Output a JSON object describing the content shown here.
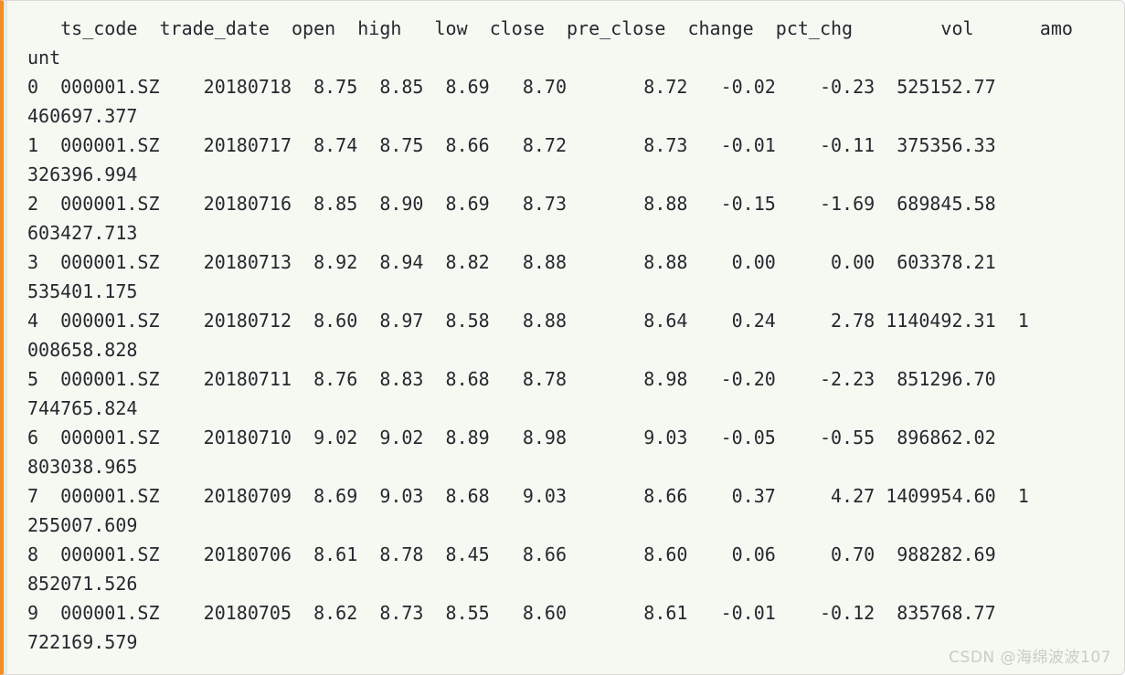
{
  "theme": {
    "background": "#f6f8f2",
    "text_color": "#24292e",
    "accent_border": "#f08d24",
    "panel_border": "#d9d9d9",
    "watermark_color": "#c9cdc6"
  },
  "console": {
    "columns": [
      "ts_code",
      "trade_date",
      "open",
      "high",
      "low",
      "close",
      "pre_close",
      "change",
      "pct_chg",
      "vol",
      "amount"
    ],
    "index_label": "",
    "lines": [
      "   ts_code  trade_date  open  high   low  close  pre_close  change  pct_chg        vol      amo",
      "unt",
      "0  000001.SZ    20180718  8.75  8.85  8.69   8.70       8.72   -0.02    -0.23  525152.77         ",
      "460697.377",
      "1  000001.SZ    20180717  8.74  8.75  8.66   8.72       8.73   -0.01    -0.11  375356.33         ",
      "326396.994",
      "2  000001.SZ    20180716  8.85  8.90  8.69   8.73       8.88   -0.15    -1.69  689845.58         ",
      "603427.713",
      "3  000001.SZ    20180713  8.92  8.94  8.82   8.88       8.88    0.00     0.00  603378.21         ",
      "535401.175",
      "4  000001.SZ    20180712  8.60  8.97  8.58   8.88       8.64    0.24     2.78 1140492.31  1",
      "008658.828",
      "5  000001.SZ    20180711  8.76  8.83  8.68   8.78       8.98   -0.20    -2.23  851296.70         ",
      "744765.824",
      "6  000001.SZ    20180710  9.02  9.02  8.89   8.98       9.03   -0.05    -0.55  896862.02         ",
      "803038.965",
      "7  000001.SZ    20180709  8.69  9.03  8.68   9.03       8.66    0.37     4.27 1409954.60  1",
      "255007.609",
      "8  000001.SZ    20180706  8.61  8.78  8.45   8.66       8.60    0.06     0.70  988282.69         ",
      "852071.526",
      "9  000001.SZ    20180705  8.62  8.73  8.55   8.60       8.61   -0.01    -0.12  835768.77         ",
      "722169.579"
    ],
    "rows": [
      {
        "index": "0",
        "ts_code": "000001.SZ",
        "trade_date": "20180718",
        "open": "8.75",
        "high": "8.85",
        "low": "8.69",
        "close": "8.70",
        "pre_close": "8.72",
        "change": "-0.02",
        "pct_chg": "-0.23",
        "vol": "525152.77",
        "amount": "460697.377"
      },
      {
        "index": "1",
        "ts_code": "000001.SZ",
        "trade_date": "20180717",
        "open": "8.74",
        "high": "8.75",
        "low": "8.66",
        "close": "8.72",
        "pre_close": "8.73",
        "change": "-0.01",
        "pct_chg": "-0.11",
        "vol": "375356.33",
        "amount": "326396.994"
      },
      {
        "index": "2",
        "ts_code": "000001.SZ",
        "trade_date": "20180716",
        "open": "8.85",
        "high": "8.90",
        "low": "8.69",
        "close": "8.73",
        "pre_close": "8.88",
        "change": "-0.15",
        "pct_chg": "-1.69",
        "vol": "689845.58",
        "amount": "603427.713"
      },
      {
        "index": "3",
        "ts_code": "000001.SZ",
        "trade_date": "20180713",
        "open": "8.92",
        "high": "8.94",
        "low": "8.82",
        "close": "8.88",
        "pre_close": "8.88",
        "change": "0.00",
        "pct_chg": "0.00",
        "vol": "603378.21",
        "amount": "535401.175"
      },
      {
        "index": "4",
        "ts_code": "000001.SZ",
        "trade_date": "20180712",
        "open": "8.60",
        "high": "8.97",
        "low": "8.58",
        "close": "8.88",
        "pre_close": "8.64",
        "change": "0.24",
        "pct_chg": "2.78",
        "vol": "1140492.31",
        "amount": "1008658.828"
      },
      {
        "index": "5",
        "ts_code": "000001.SZ",
        "trade_date": "20180711",
        "open": "8.76",
        "high": "8.83",
        "low": "8.68",
        "close": "8.78",
        "pre_close": "8.98",
        "change": "-0.20",
        "pct_chg": "-2.23",
        "vol": "851296.70",
        "amount": "744765.824"
      },
      {
        "index": "6",
        "ts_code": "000001.SZ",
        "trade_date": "20180710",
        "open": "9.02",
        "high": "9.02",
        "low": "8.89",
        "close": "8.98",
        "pre_close": "9.03",
        "change": "-0.05",
        "pct_chg": "-0.55",
        "vol": "896862.02",
        "amount": "803038.965"
      },
      {
        "index": "7",
        "ts_code": "000001.SZ",
        "trade_date": "20180709",
        "open": "8.69",
        "high": "9.03",
        "low": "8.68",
        "close": "9.03",
        "pre_close": "8.66",
        "change": "0.37",
        "pct_chg": "4.27",
        "vol": "1409954.60",
        "amount": "1255007.609"
      },
      {
        "index": "8",
        "ts_code": "000001.SZ",
        "trade_date": "20180706",
        "open": "8.61",
        "high": "8.78",
        "low": "8.45",
        "close": "8.66",
        "pre_close": "8.60",
        "change": "0.06",
        "pct_chg": "0.70",
        "vol": "988282.69",
        "amount": "852071.526"
      },
      {
        "index": "9",
        "ts_code": "000001.SZ",
        "trade_date": "20180705",
        "open": "8.62",
        "high": "8.73",
        "low": "8.55",
        "close": "8.60",
        "pre_close": "8.61",
        "change": "-0.01",
        "pct_chg": "-0.12",
        "vol": "835768.77",
        "amount": "722169.579"
      }
    ]
  },
  "watermark": {
    "text": "CSDN @海绵波波107"
  }
}
